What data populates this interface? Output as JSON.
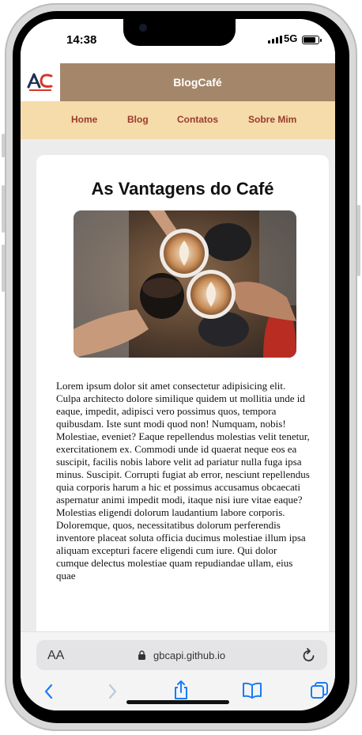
{
  "status": {
    "time": "14:38",
    "network": "5G"
  },
  "site": {
    "brand": "BlogCafé",
    "logo_text": "AC",
    "nav": [
      "Home",
      "Blog",
      "Contatos",
      "Sobre Mim"
    ]
  },
  "article": {
    "title": "As Vantagens do Café",
    "image_alt": "mãos brindando com xícaras de café",
    "body": "Lorem ipsum dolor sit amet consectetur adipisicing elit. Culpa architecto dolore similique quidem ut mollitia unde id eaque, impedit, adipisci vero possimus quos, tempora quibusdam. Iste sunt modi quod non! Numquam, nobis! Molestiae, eveniet? Eaque repellendus molestias velit tenetur, exercitationem ex. Commodi unde id quaerat neque eos ea suscipit, facilis nobis labore velit ad pariatur nulla fuga ipsa minus. Suscipit. Corrupti fugiat ab error, nesciunt repellendus quia corporis harum a hic et possimus accusamus obcaecati aspernatur animi impedit modi, itaque nisi iure vitae eaque? Molestias eligendi dolorum laudantium labore corporis. Doloremque, quos, necessitatibus dolorum perferendis inventore placeat soluta officia ducimus molestiae illum ipsa aliquam excepturi facere eligendi cum iure. Qui dolor cumque delectus molestiae quam repudiandae ullam, eius quae"
  },
  "browser": {
    "text_size_label": "AA",
    "url": "gbcapi.github.io"
  },
  "colors": {
    "header": "#a4876a",
    "nav": "#f5dcaa",
    "nav_text": "#9a3b2c",
    "ios_blue": "#1a7cf5"
  }
}
